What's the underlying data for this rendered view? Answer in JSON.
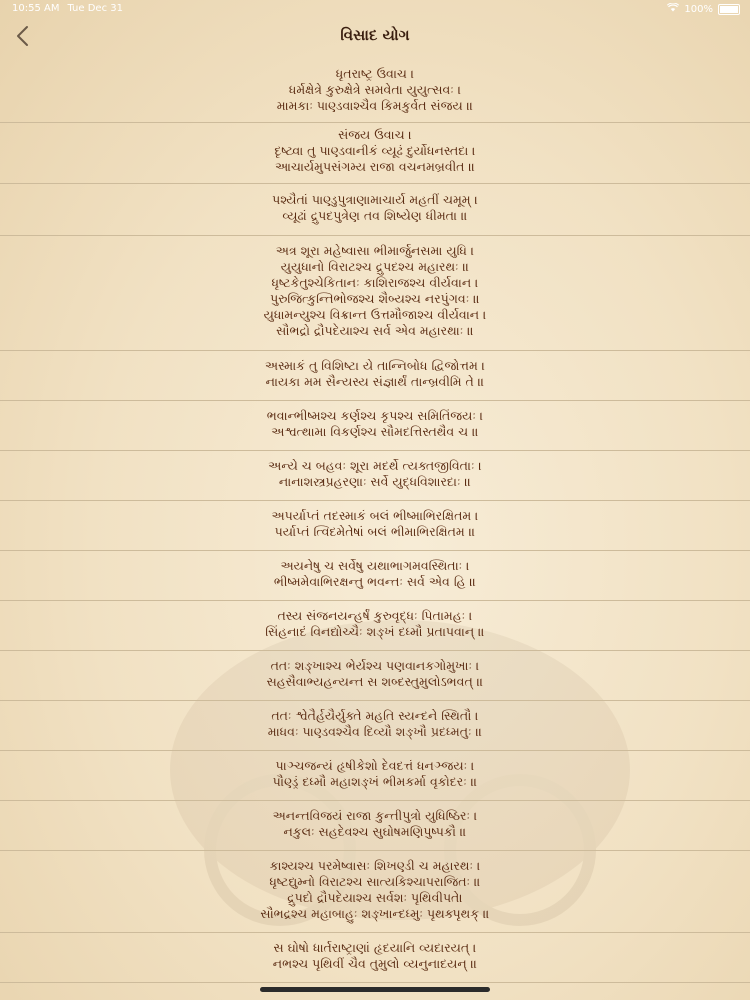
{
  "status_bar": {
    "time": "10:55 AM",
    "date": "Tue Dec 31",
    "battery": "100%"
  },
  "header": {
    "title": "વિસાદ યોગ"
  },
  "verses": [
    [
      "ધૃતરાષ્ટ્ર ઉવાચ ।",
      "ધર્મક્ષેત્રે કુરુક્ષેત્રે સમવેતા યુયુત્સવઃ ।",
      "મામકાઃ પાણ્ડવાશ્ચૈવ કિમકુર્વત સંજય ॥"
    ],
    [
      "સંજય ઉવાચ ।",
      "દૃષ્ટ્વા તુ પાણ્ડવાનીકં વ્યૂઢં દુર્યોધનસ્તદા ।",
      "આચાર્યમુપસંગમ્ય રાજા વચનમબ્રવીત ॥"
    ],
    [
      "પશ્યૈતાં પાણ્ડુપુત્રાણામાચાર્ય મહતીં ચમૂમ્ ।",
      "વ્યૂઢાં દ્રુપદપુત્રેણ તવ શિષ્યેણ ધીમતા ॥"
    ],
    [
      "અત્ર શૂરા મહેષ્વાસા ભીમાર્જુનસમા યુધિ ।",
      "યુયુધાનો વિરાટશ્ચ દ્રુપદશ્ચ મહારથઃ ॥",
      "ધૃષ્ટકેતુશ્ચેકિતાનઃ કાશિરાજશ્ચ વીર્યવાન ।",
      "પુરુજિત્કુન્તિભોજશ્ચ શૈબ્યશ્ચ નરપુંગવઃ ॥",
      "યુધામન્યુશ્ચ વિક્રાન્ત ઉત્તમૌજાશ્ચ વીર્યવાન ।",
      "સૌભદ્રો દ્રૌપદેયાશ્ચ સર્વ એવ મહારથાઃ ॥"
    ],
    [
      "અસ્માકં તુ વિશિષ્ટા યે તાન્નિબોધ દ્વિજોત્તમ ।",
      "નાયકા મમ સૈન્યસ્ય સંજ્ઞાર્થં તાન્બ્રવીમિ તે ॥"
    ],
    [
      "ભવાન્ભીષ્મશ્ચ કર્ણશ્ચ કૃપશ્ચ સમિતિંજયઃ ।",
      "અશ્વત્થામા વિકર્ણશ્ચ સૌમદત્તિસ્તથૈવ ચ ॥"
    ],
    [
      "અન્યે ચ બહવઃ શૂરા મદર્થે ત્યક્તજીવિતાઃ ।",
      "નાનાશસ્ત્રપ્રહરણાઃ સર્વે યુદ્ધવિશારદાઃ ॥"
    ],
    [
      "અપર્યાપ્તં તદસ્માકં બલં ભીષ્માભિરક્ષિતમ ।",
      "પર્યાપ્તં ત્વિદમેતેષાં બલં ભીમાભિરક્ષિતમ ॥"
    ],
    [
      "અયનેષુ ચ સર્વેષુ યથાભાગમવસ્થિતાઃ ।",
      "ભીષ્મમેવાભિરક્ષન્તુ ભવન્તઃ સર્વ એવ હિ ॥"
    ],
    [
      "તસ્ય સંજનયન્હર્ષં કુરુવૃદ્ધઃ પિતામહઃ ।",
      "સિંહનાદં વિનદ્યોચ્ચૈઃ શઙ્ખં દધ્મૌ પ્રતાપવાન્ ॥"
    ],
    [
      "તતઃ શઙ્ખાશ્ચ ભેર્યશ્ચ પણવાનકગોમુખાઃ ।",
      "સહસૈવાભ્યહન્યન્ત સ શબ્દસ્તુમુલોઽભવત્ ॥"
    ],
    [
      "તતઃ શ્વેતૈર્હયૈર્યુક્તે મહતિ સ્યન્દને સ્થિતૌ ।",
      "માધવઃ પાણ્ડવશ્ચૈવ દિવ્યૌ શઙ્ખૌ પ્રદધ્મતુઃ ॥"
    ],
    [
      "પાઞ્ચજન્યં હૃષીકેશો દેવદત્તં ધનઞ્જયઃ ।",
      "પૌણ્ડ્રં દધ્મૌ મહાશઙ્ખં ભીમકર્મા વૃકોદરઃ ॥"
    ],
    [
      "અનન્તવિજયં રાજા કુન્તીપુત્રો યુધિષ્ઠિરઃ ।",
      "નકુલઃ સહદેવશ્ચ સુઘોષમણિપુષ્પકૌ ॥"
    ],
    [
      "કાશ્યશ્ચ પરમેષ્વાસઃ શિખણ્ડી ચ મહારથઃ ।",
      "ધૃષ્ટદ્યુમ્નો વિરાટશ્ચ સાત્યકિશ્ચાપરાજિતઃ ॥",
      "દ્રુપદો દ્રૌપદેયાશ્ચ સર્વશઃ પૃથિવીપતે।",
      "સૌભદ્રશ્ચ મહાબાહુઃ શઙ્ખાન્દધ્મુઃ પૃથક્પૃથક્ ॥"
    ],
    [
      "સ ઘોષો ધાર્તરાષ્ટ્રાણાં હૃદયાનિ વ્યદારયત્ ।",
      "નભશ્ચ પૃથિવીં ચૈવ તુમુલો વ્યનુનાદયન્ ॥"
    ]
  ]
}
